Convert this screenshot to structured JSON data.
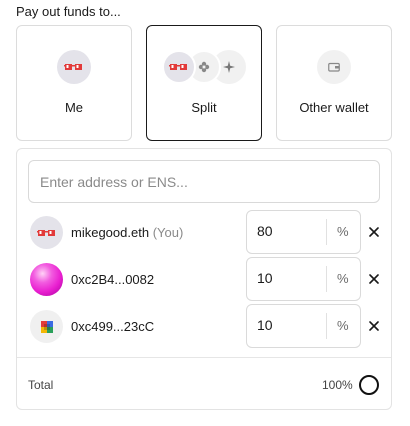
{
  "heading": "Pay out funds to...",
  "options": [
    {
      "label": "Me",
      "selected": false
    },
    {
      "label": "Split",
      "selected": true
    },
    {
      "label": "Other wallet",
      "selected": false
    }
  ],
  "address_input": {
    "placeholder": "Enter address or ENS...",
    "value": ""
  },
  "recipients": [
    {
      "name": "mikegood.eth",
      "suffix": "(You)",
      "percent": "80",
      "unit": "%",
      "avatar": "red-glasses-avatar"
    },
    {
      "name": "0xc2B4...0082",
      "suffix": "",
      "percent": "10",
      "unit": "%",
      "avatar": "pink-sphere-avatar"
    },
    {
      "name": "0xc499...23cC",
      "suffix": "",
      "percent": "10",
      "unit": "%",
      "avatar": "pixel-blocks-avatar"
    }
  ],
  "total": {
    "label": "Total",
    "value": "100%"
  },
  "colors": {
    "border_selected": "#1a1a1a",
    "avatar_bg": "#e4e3ea",
    "glasses_red": "#e23a3a",
    "sphere_pink": "#e91fd0"
  }
}
